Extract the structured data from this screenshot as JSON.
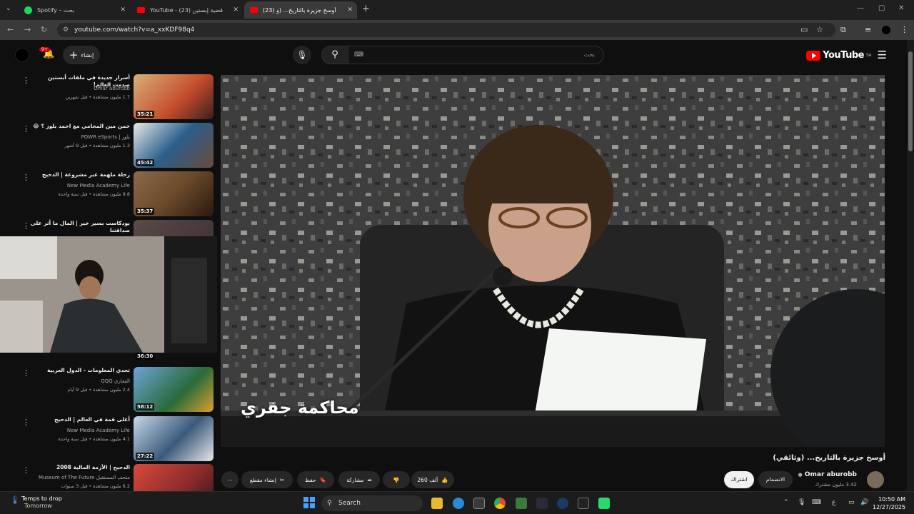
{
  "browser": {
    "tabs": [
      {
        "title": "Spotify – بحث",
        "icon": "spotify-icon",
        "color": "#1ed760"
      },
      {
        "title": "YouTube - قضية إبستين (23)",
        "icon": "youtube-icon",
        "color": "#ff0000"
      },
      {
        "title": "(23) أوسخ جزيرة بالتاريخ... (و",
        "icon": "youtube-icon",
        "color": "#ff0000",
        "active": true
      }
    ],
    "url": "youtube.com/watch?v=a_xxKDF98q4"
  },
  "yt_header": {
    "logo": "YouTube",
    "region": "SA",
    "search_placeholder": "بحث",
    "create_label": "إنشاء",
    "notif_count": "9+"
  },
  "recommended": [
    {
      "title": "أسرار جديدة في ملفات أبستين صدمت العالم!",
      "channel": "Omar aburobb",
      "meta": "1.7 مليون مشاهدة • قبل شهرين",
      "duration": "35:21",
      "thumb_color": "#c24a2a"
    },
    {
      "title": "خمن مين المحامي مع احمد بلوز ؟ 😂",
      "channel": "POWR eSports | بلوز",
      "meta": "1.3 مليون مشاهدة • قبل 9 أشهر",
      "duration": "45:42",
      "thumb_color": "#2a5f8a"
    },
    {
      "title": "رحلة ملهمة عبر مشروعة | الدحيح",
      "channel": "New Media Academy Life",
      "meta": "9.8 مليون مشاهدة • قبل سنة واحدة",
      "duration": "35:37",
      "thumb_color": "#6b4a2a"
    },
    {
      "title": "بودكاست بسير خير | المال ما أثر على صداقتنا",
      "channel": "",
      "meta": "",
      "duration": "",
      "thumb_color": "#3a3030"
    },
    {
      "title": "تحدي المعلومات - الدول العربية",
      "channel": "QQQ الفقاري",
      "meta": "2.4 مليون مشاهدة • قبل 9 أيام",
      "duration": "58:12",
      "thumb_color": "#2a6a3a"
    },
    {
      "title": "أغلى قمة في العالم | الدحيح",
      "channel": "New Media Academy Life",
      "meta": "4.1 مليون مشاهدة • قبل سنة واحدة",
      "duration": "27:22",
      "thumb_color": "#3a5a7a"
    },
    {
      "title": "الدحيح | الأزمة المالية 2008",
      "channel": "Museum of The Future متحف المستقبل",
      "meta": "6.2 مليون مشاهدة • قبل 3 سنوات",
      "duration": "",
      "thumb_color": "#8a2a2a"
    }
  ],
  "webcam_duration": "36:30",
  "player": {
    "caption": "محاكمة جفري",
    "title": "أوسخ جزيرة بالتاريخ... (وثائقي)"
  },
  "channel": {
    "name": "Omar aburobb",
    "subs": "3.42 مليون مشترك"
  },
  "actions": {
    "subscribe": "اشتراك",
    "join": "الانضمام",
    "likes": "260 ألف",
    "share": "مشاركة",
    "save": "حفظ",
    "clip": "إنشاء مقطع"
  },
  "taskbar": {
    "weather_title": "Temps to drop",
    "weather_sub": "Tomorrow",
    "search": "Search",
    "lang": "ع",
    "time": "10:50 AM",
    "date": "12/27/2025"
  }
}
